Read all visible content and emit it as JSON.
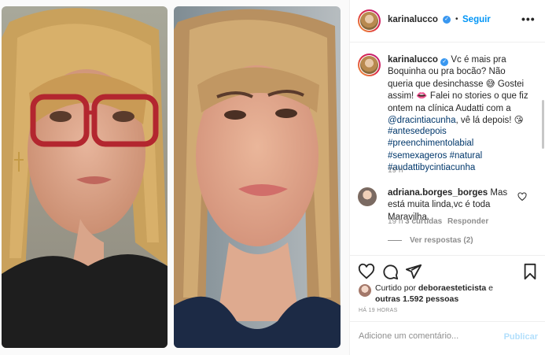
{
  "header": {
    "username": "karinalucco",
    "separator": "•",
    "follow_label": "Seguir",
    "more_label": "•••"
  },
  "caption": {
    "username": "karinalucco",
    "text": "Vc é mais pra Boquinha ou pra bocão? Não queria que desinchasse 😅 Gostei assim! 👄 Falei no stories o que fiz ontem na clínica Audatti com a",
    "mention": "@dracintiacunha",
    "text_after": ", vê lá depois! 😘",
    "hashtags": [
      "#antesedepois",
      "#preenchimentolabial",
      "#semexageros",
      "#natural",
      "#audattibycintiacunha"
    ],
    "time": "19 h"
  },
  "comment": {
    "username": "adriana.borges_borges",
    "text": "Mas está muita linda,vc é toda Maravilha.",
    "time": "19 h",
    "likes": "3 curtidas",
    "reply_label": "Responder",
    "view_replies": "Ver respostas (2)"
  },
  "likes": {
    "prefix": "Curtido por",
    "user": "deboraesteticista",
    "conj": "e",
    "others": "outras 1.592 pessoas"
  },
  "time_ago": "HÁ 19 HORAS",
  "add_comment": {
    "placeholder": "Adicione um comentário...",
    "post_label": "Publicar"
  },
  "colors": {
    "accent": "#0095f6",
    "hashtag": "#00376b",
    "muted": "#8e8e8e",
    "verified": "#3897f0",
    "post_disabled": "#b2dffc"
  },
  "icons": [
    "verified-icon",
    "heart-icon",
    "comment-icon",
    "share-icon",
    "bookmark-icon",
    "more-icon"
  ]
}
